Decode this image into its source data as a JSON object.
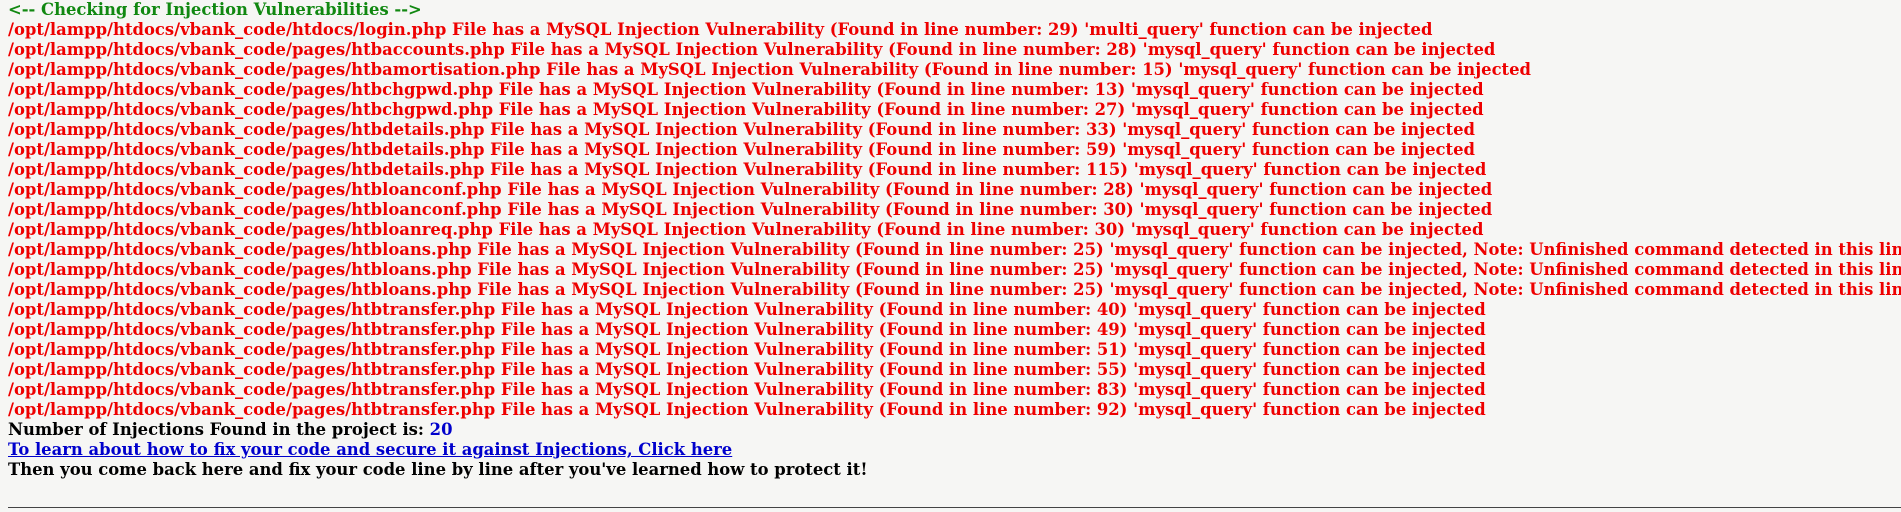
{
  "report": {
    "header": "<-- Checking for Injection Vulnerabilities -->",
    "findings": [
      "/opt/lampp/htdocs/vbank_code/htdocs/login.php File has a MySQL Injection Vulnerability (Found in line number: 29) 'multi_query' function can be injected",
      "/opt/lampp/htdocs/vbank_code/pages/htbaccounts.php File has a MySQL Injection Vulnerability (Found in line number: 28) 'mysql_query' function can be injected",
      "/opt/lampp/htdocs/vbank_code/pages/htbamortisation.php File has a MySQL Injection Vulnerability (Found in line number: 15) 'mysql_query' function can be injected",
      "/opt/lampp/htdocs/vbank_code/pages/htbchgpwd.php File has a MySQL Injection Vulnerability (Found in line number: 13) 'mysql_query' function can be injected",
      "/opt/lampp/htdocs/vbank_code/pages/htbchgpwd.php File has a MySQL Injection Vulnerability (Found in line number: 27) 'mysql_query' function can be injected",
      "/opt/lampp/htdocs/vbank_code/pages/htbdetails.php File has a MySQL Injection Vulnerability (Found in line number: 33) 'mysql_query' function can be injected",
      "/opt/lampp/htdocs/vbank_code/pages/htbdetails.php File has a MySQL Injection Vulnerability (Found in line number: 59) 'mysql_query' function can be injected",
      "/opt/lampp/htdocs/vbank_code/pages/htbdetails.php File has a MySQL Injection Vulnerability (Found in line number: 115) 'mysql_query' function can be injected",
      "/opt/lampp/htdocs/vbank_code/pages/htbloanconf.php File has a MySQL Injection Vulnerability (Found in line number: 28) 'mysql_query' function can be injected",
      "/opt/lampp/htdocs/vbank_code/pages/htbloanconf.php File has a MySQL Injection Vulnerability (Found in line number: 30) 'mysql_query' function can be injected",
      "/opt/lampp/htdocs/vbank_code/pages/htbloanreq.php File has a MySQL Injection Vulnerability (Found in line number: 30) 'mysql_query' function can be injected",
      "/opt/lampp/htdocs/vbank_code/pages/htbloans.php File has a MySQL Injection Vulnerability (Found in line number: 25) 'mysql_query' function can be injected, Note: Unfinished command detected in this line.",
      "/opt/lampp/htdocs/vbank_code/pages/htbloans.php File has a MySQL Injection Vulnerability (Found in line number: 25) 'mysql_query' function can be injected, Note: Unfinished command detected in this line.",
      "/opt/lampp/htdocs/vbank_code/pages/htbloans.php File has a MySQL Injection Vulnerability (Found in line number: 25) 'mysql_query' function can be injected, Note: Unfinished command detected in this line.",
      "/opt/lampp/htdocs/vbank_code/pages/htbtransfer.php File has a MySQL Injection Vulnerability (Found in line number: 40) 'mysql_query' function can be injected",
      "/opt/lampp/htdocs/vbank_code/pages/htbtransfer.php File has a MySQL Injection Vulnerability (Found in line number: 49) 'mysql_query' function can be injected",
      "/opt/lampp/htdocs/vbank_code/pages/htbtransfer.php File has a MySQL Injection Vulnerability (Found in line number: 51) 'mysql_query' function can be injected",
      "/opt/lampp/htdocs/vbank_code/pages/htbtransfer.php File has a MySQL Injection Vulnerability (Found in line number: 55) 'mysql_query' function can be injected",
      "/opt/lampp/htdocs/vbank_code/pages/htbtransfer.php File has a MySQL Injection Vulnerability (Found in line number: 83) 'mysql_query' function can be injected",
      "/opt/lampp/htdocs/vbank_code/pages/htbtransfer.php File has a MySQL Injection Vulnerability (Found in line number: 92) 'mysql_query' function can be injected"
    ],
    "summary_label": "Number of Injections Found in the project is: ",
    "summary_count": "20",
    "learn_link_text": "To learn about how to fix your code and secure it against Injections, Click here",
    "closing_text": "Then you come back here and fix your code line by line after you've learned how to protect it!"
  },
  "colors": {
    "background": "#f6f6f4",
    "header": "#118811",
    "vulnerability": "#ee0000",
    "count": "#0000cc",
    "link": "#0000cc",
    "text": "#000000"
  }
}
